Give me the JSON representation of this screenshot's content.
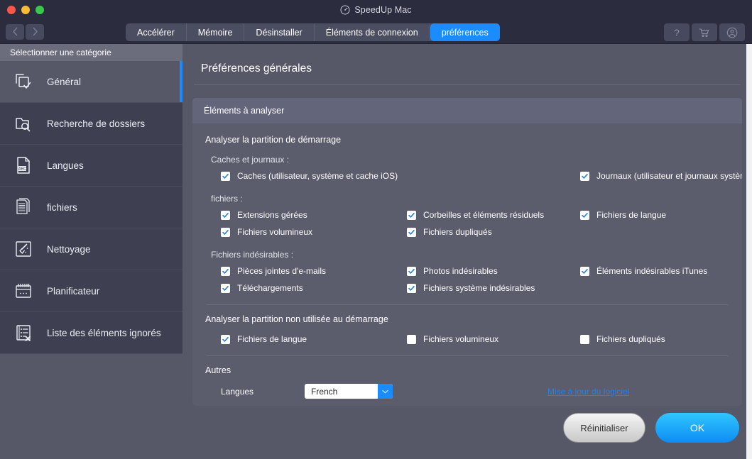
{
  "window": {
    "title": "SpeedUp Mac",
    "logo_icon": "gauge-icon",
    "traffic_lights": [
      "close",
      "minimize",
      "zoom"
    ]
  },
  "toolbar": {
    "back_icon": "chevron-left-icon",
    "forward_icon": "chevron-right-icon",
    "tabs": [
      {
        "label": "Accélérer",
        "active": false
      },
      {
        "label": "Mémoire",
        "active": false
      },
      {
        "label": "Désinstaller",
        "active": false
      },
      {
        "label": "Éléments de connexion",
        "active": false
      },
      {
        "label": "préférences",
        "active": true
      }
    ],
    "actions": [
      {
        "name": "help-button",
        "icon": "question-mark-icon",
        "label": "?"
      },
      {
        "name": "cart-button",
        "icon": "shopping-cart-icon",
        "label": ""
      },
      {
        "name": "account-button",
        "icon": "user-account-icon",
        "label": ""
      }
    ]
  },
  "sidebar": {
    "header": "Sélectionner une catégorie",
    "items": [
      {
        "label": "Général",
        "icon": "copy-check-icon",
        "active": true
      },
      {
        "label": "Recherche de dossiers",
        "icon": "folder-search-icon",
        "active": false
      },
      {
        "label": "Langues",
        "icon": "abc-document-icon",
        "active": false
      },
      {
        "label": "fichiers",
        "icon": "documents-stack-icon",
        "active": false
      },
      {
        "label": "Nettoyage",
        "icon": "broom-icon",
        "active": false
      },
      {
        "label": "Planificateur",
        "icon": "calendar-icon",
        "active": false
      },
      {
        "label": "Liste des éléments ignorés",
        "icon": "list-x-icon",
        "active": false
      }
    ]
  },
  "main": {
    "page_title": "Préférences générales",
    "panel_header": "Éléments à analyser",
    "startup_section": {
      "title": "Analyser la partition de démarrage",
      "caches_label": "Caches et journaux :",
      "caches_items": [
        {
          "label": "Caches (utilisateur, système et cache iOS)",
          "checked": true
        },
        {
          "label": "Journaux (utilisateur et journaux système)",
          "checked": true
        }
      ],
      "files_label": "fichiers :",
      "files_items": [
        {
          "label": "Extensions gérées",
          "checked": true
        },
        {
          "label": "Corbeilles et éléments résiduels",
          "checked": true
        },
        {
          "label": "Fichiers de langue",
          "checked": true
        },
        {
          "label": "Fichiers volumineux",
          "checked": true
        },
        {
          "label": "Fichiers dupliqués",
          "checked": true
        },
        {
          "label": "",
          "checked": null
        }
      ],
      "junk_label": "Fichiers indésirables :",
      "junk_items": [
        {
          "label": "Pièces jointes d'e-mails",
          "checked": true
        },
        {
          "label": "Photos indésirables",
          "checked": true
        },
        {
          "label": "Éléments indésirables iTunes",
          "checked": true
        },
        {
          "label": "Téléchargements",
          "checked": true
        },
        {
          "label": "Fichiers système indésirables",
          "checked": true
        },
        {
          "label": "",
          "checked": null
        }
      ]
    },
    "nonstartup_section": {
      "title": "Analyser la partition non utilisée au démarrage",
      "items": [
        {
          "label": "Fichiers de langue",
          "checked": true
        },
        {
          "label": "Fichiers volumineux",
          "checked": false
        },
        {
          "label": "Fichiers dupliqués",
          "checked": false
        }
      ]
    },
    "other_section": {
      "title": "Autres",
      "language_label": "Langues",
      "language_value": "French",
      "update_link": "Mise à jour du logiciel"
    }
  },
  "footer": {
    "reset_label": "Réinitialiser",
    "ok_label": "OK"
  },
  "colors": {
    "accent": "#1a8cff",
    "panel": "#5b5d6d",
    "sidebar": "#3e4052",
    "titlebar": "#2b2d3e",
    "link": "#2a7fe0"
  }
}
